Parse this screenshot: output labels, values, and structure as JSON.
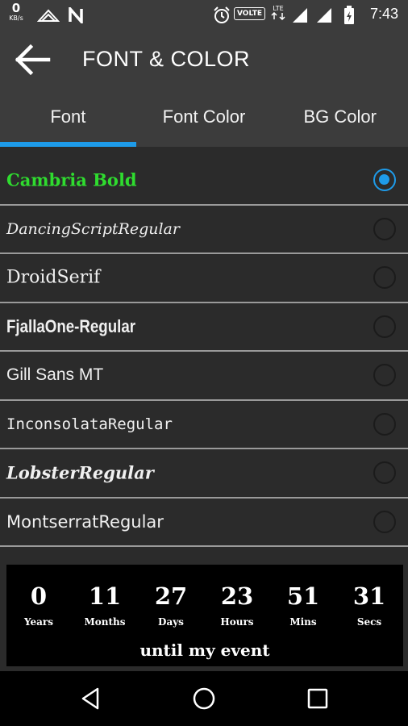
{
  "status_bar": {
    "net_speed": "0",
    "net_unit": "KB/s",
    "volte": "VOLTE",
    "lte": "LTE",
    "time": "7:43"
  },
  "app_bar": {
    "title": "FONT & COLOR",
    "back_icon": "arrow-left-icon"
  },
  "tabs": [
    {
      "label": "Font",
      "active": true
    },
    {
      "label": "Font Color",
      "active": false
    },
    {
      "label": "BG Color",
      "active": false
    }
  ],
  "fonts": [
    {
      "label": "Cambria Bold",
      "selected": true
    },
    {
      "label": "DancingScriptRegular",
      "selected": false
    },
    {
      "label": "DroidSerif",
      "selected": false
    },
    {
      "label": "FjallaOne-Regular",
      "selected": false
    },
    {
      "label": "Gill Sans MT",
      "selected": false
    },
    {
      "label": "InconsolataRegular",
      "selected": false
    },
    {
      "label": "LobsterRegular",
      "selected": false
    },
    {
      "label": "MontserratRegular",
      "selected": false
    }
  ],
  "countdown": {
    "units": [
      {
        "value": "0",
        "label": "Years"
      },
      {
        "value": "11",
        "label": "Months"
      },
      {
        "value": "27",
        "label": "Days"
      },
      {
        "value": "23",
        "label": "Hours"
      },
      {
        "value": "51",
        "label": "Mins"
      },
      {
        "value": "31",
        "label": "Secs"
      }
    ],
    "caption": "until my event"
  },
  "colors": {
    "accent": "#1e9be9",
    "selected_font_text": "#2fdc2f",
    "app_bar_bg": "#3c3c3c",
    "list_bg": "#2b2b2b",
    "divider": "#9a9a9a"
  },
  "nav_bar": {
    "buttons": [
      "back-triangle-icon",
      "home-circle-icon",
      "recents-square-icon"
    ]
  }
}
